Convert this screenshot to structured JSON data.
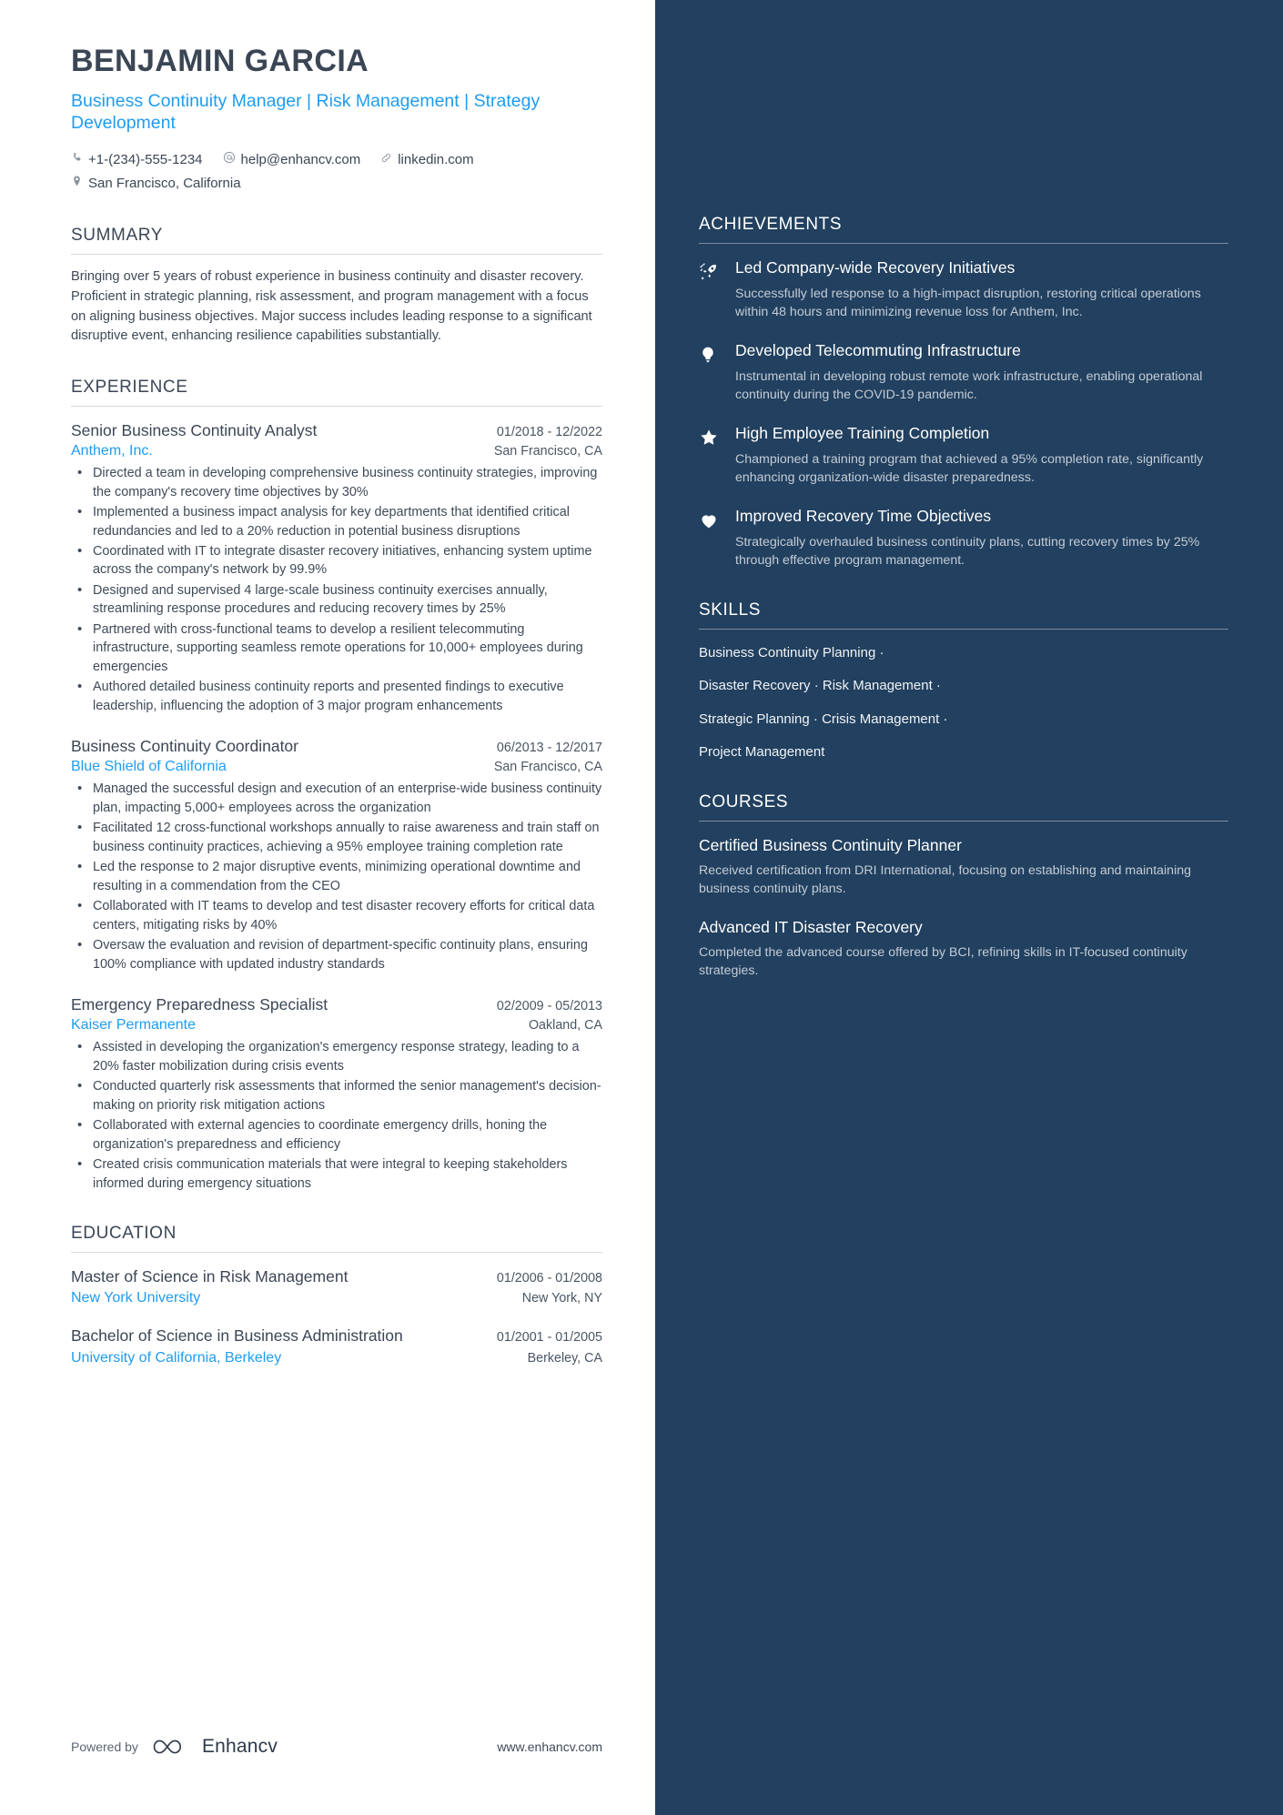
{
  "header": {
    "name": "BENJAMIN GARCIA",
    "headline": "Business Continuity Manager | Risk Management | Strategy Development",
    "contacts": [
      {
        "icon": "phone-icon",
        "text": "+1-(234)-555-1234"
      },
      {
        "icon": "email-icon",
        "text": "help@enhancv.com"
      },
      {
        "icon": "link-icon",
        "text": "linkedin.com"
      },
      {
        "icon": "location-icon",
        "text": "San Francisco, California"
      }
    ]
  },
  "summary": {
    "title": "SUMMARY",
    "text": "Bringing over 5 years of robust experience in business continuity and disaster recovery. Proficient in strategic planning, risk assessment, and program management with a focus on aligning business objectives. Major success includes leading response to a significant disruptive event, enhancing resilience capabilities substantially."
  },
  "experience": {
    "title": "EXPERIENCE",
    "jobs": [
      {
        "title": "Senior Business Continuity Analyst",
        "date": "01/2018 - 12/2022",
        "company": "Anthem, Inc.",
        "location": "San Francisco, CA",
        "bullets": [
          "Directed a team in developing comprehensive business continuity strategies, improving the company's recovery time objectives by 30%",
          "Implemented a business impact analysis for key departments that identified critical redundancies and led to a 20% reduction in potential business disruptions",
          "Coordinated with IT to integrate disaster recovery initiatives, enhancing system uptime across the company's network by 99.9%",
          "Designed and supervised 4 large-scale business continuity exercises annually, streamlining response procedures and reducing recovery times by 25%",
          "Partnered with cross-functional teams to develop a resilient telecommuting infrastructure, supporting seamless remote operations for 10,000+ employees during emergencies",
          "Authored detailed business continuity reports and presented findings to executive leadership, influencing the adoption of 3 major program enhancements"
        ]
      },
      {
        "title": "Business Continuity Coordinator",
        "date": "06/2013 - 12/2017",
        "company": "Blue Shield of California",
        "location": "San Francisco, CA",
        "bullets": [
          "Managed the successful design and execution of an enterprise-wide business continuity plan, impacting 5,000+ employees across the organization",
          "Facilitated 12 cross-functional workshops annually to raise awareness and train staff on business continuity practices, achieving a 95% employee training completion rate",
          "Led the response to 2 major disruptive events, minimizing operational downtime and resulting in a commendation from the CEO",
          "Collaborated with IT teams to develop and test disaster recovery efforts for critical data centers, mitigating risks by 40%",
          "Oversaw the evaluation and revision of department-specific continuity plans, ensuring 100% compliance with updated industry standards"
        ]
      },
      {
        "title": "Emergency Preparedness Specialist",
        "date": "02/2009 - 05/2013",
        "company": "Kaiser Permanente",
        "location": "Oakland, CA",
        "bullets": [
          "Assisted in developing the organization's emergency response strategy, leading to a 20% faster mobilization during crisis events",
          "Conducted quarterly risk assessments that informed the senior management's decision-making on priority risk mitigation actions",
          "Collaborated with external agencies to coordinate emergency drills, honing the organization's preparedness and efficiency",
          "Created crisis communication materials that were integral to keeping stakeholders informed during emergency situations"
        ]
      }
    ]
  },
  "education": {
    "title": "EDUCATION",
    "entries": [
      {
        "degree": "Master of Science in Risk Management",
        "date": "01/2006 - 01/2008",
        "school": "New York University",
        "location": "New York, NY"
      },
      {
        "degree": "Bachelor of Science in Business Administration",
        "date": "01/2001 - 01/2005",
        "school": "University of California, Berkeley",
        "location": "Berkeley, CA"
      }
    ]
  },
  "achievements": {
    "title": "ACHIEVEMENTS",
    "items": [
      {
        "icon": "rocket-icon",
        "title": "Led Company-wide Recovery Initiatives",
        "description": "Successfully led response to a high-impact disruption, restoring critical operations within 48 hours and minimizing revenue loss for Anthem, Inc."
      },
      {
        "icon": "lightbulb-icon",
        "title": "Developed Telecommuting Infrastructure",
        "description": "Instrumental in developing robust remote work infrastructure, enabling operational continuity during the COVID-19 pandemic."
      },
      {
        "icon": "star-icon",
        "title": "High Employee Training Completion",
        "description": "Championed a training program that achieved a 95% completion rate, significantly enhancing organization-wide disaster preparedness."
      },
      {
        "icon": "heart-icon",
        "title": "Improved Recovery Time Objectives",
        "description": "Strategically overhauled business continuity plans, cutting recovery times by 25% through effective program management."
      }
    ]
  },
  "skills": {
    "title": "SKILLS",
    "lines": [
      "Business Continuity Planning ·",
      "Disaster Recovery · Risk Management ·",
      "Strategic Planning · Crisis Management ·",
      "Project Management"
    ]
  },
  "courses": {
    "title": "COURSES",
    "items": [
      {
        "title": "Certified Business Continuity Planner",
        "description": "Received certification from DRI International, focusing on establishing and maintaining business continuity plans."
      },
      {
        "title": "Advanced IT Disaster Recovery",
        "description": "Completed the advanced course offered by BCI, refining skills in IT-focused continuity strategies."
      }
    ]
  },
  "footer": {
    "powered_by": "Powered by",
    "brand": "Enhancv",
    "website": "www.enhancv.com"
  },
  "colors": {
    "sidebar_bg": "#22405f",
    "accent_blue": "#1f9cf0",
    "heading": "#3b4655"
  }
}
